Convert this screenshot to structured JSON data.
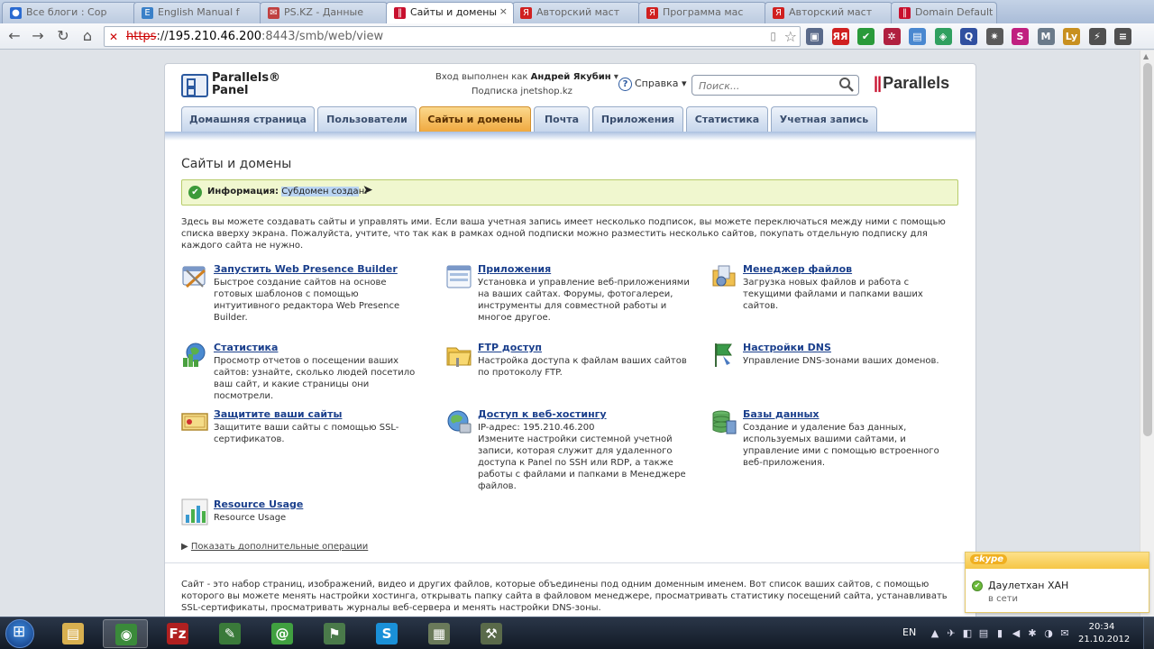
{
  "browser": {
    "tabs": [
      {
        "label": "Все блоги : Сор",
        "icon_color": "#2a6ad0",
        "glyph": "●"
      },
      {
        "label": "English Manual f",
        "icon_color": "#3a80c8",
        "glyph": "E"
      },
      {
        "label": "PS.KZ - Данные",
        "icon_color": "#c04040",
        "glyph": "✉"
      },
      {
        "label": "Сайты и домены",
        "icon_color": "#c8102e",
        "glyph": "‖"
      },
      {
        "label": "Авторский маст",
        "icon_color": "#d02020",
        "glyph": "Я"
      },
      {
        "label": "Программа мас",
        "icon_color": "#d02020",
        "glyph": "Я"
      },
      {
        "label": "Авторский маст",
        "icon_color": "#d02020",
        "glyph": "Я"
      },
      {
        "label": "Domain Default",
        "icon_color": "#c8102e",
        "glyph": "‖"
      }
    ],
    "tab_close_glyph": "×",
    "url_scheme": "https",
    "url_rest": "://",
    "url_host": "195.210.46.200",
    "url_path": ":8443/smb/web/view",
    "nav_back": "←",
    "nav_forward": "→",
    "nav_reload": "↻",
    "nav_home": "⌂",
    "security_glyph": "✕",
    "star_glyph": "☆",
    "extensions": [
      {
        "name": "ext-photo-icon",
        "color": "#5a6a8a",
        "glyph": "▣"
      },
      {
        "name": "ext-yandex-icon",
        "color": "#d02020",
        "glyph": "ЯЯ"
      },
      {
        "name": "ext-check-icon",
        "color": "#2a9a3a",
        "glyph": "✔"
      },
      {
        "name": "ext-puzzle-icon",
        "color": "#b02040",
        "glyph": "✲"
      },
      {
        "name": "ext-doc-icon",
        "color": "#4a88d0",
        "glyph": "▤"
      },
      {
        "name": "ext-color-icon",
        "color": "#30a060",
        "glyph": "◈"
      },
      {
        "name": "ext-translate-icon",
        "color": "#3050a0",
        "glyph": "Q"
      },
      {
        "name": "ext-gear-icon",
        "color": "#5a5a5a",
        "glyph": "✷"
      },
      {
        "name": "ext-s-icon",
        "color": "#c02080",
        "glyph": "S"
      },
      {
        "name": "ext-mail-icon",
        "color": "#6a7a8a",
        "glyph": "M"
      },
      {
        "name": "ext-ly-icon",
        "color": "#c89020",
        "glyph": "Ly"
      },
      {
        "name": "ext-bolt-icon",
        "color": "#505050",
        "glyph": "⚡"
      },
      {
        "name": "ext-menu-icon",
        "color": "#505050",
        "glyph": "≡"
      }
    ]
  },
  "header": {
    "logo_line1": "Parallels®",
    "logo_line2": "Panel",
    "login_prefix": "Вход выполнен как",
    "login_user": "Андрей Якубин",
    "login_caret": "▾",
    "subscription": "Подписка jnetshop.kz",
    "help_label": "Справка",
    "help_glyph": "?",
    "help_caret": "▾",
    "search_placeholder": "Поиск...",
    "brand": "Parallels",
    "brand_bars": "||"
  },
  "nav": {
    "tabs": [
      {
        "label": "Домашняя страница"
      },
      {
        "label": "Пользователи"
      },
      {
        "label": "Сайты и домены"
      },
      {
        "label": "Почта"
      },
      {
        "label": "Приложения"
      },
      {
        "label": "Статистика"
      },
      {
        "label": "Учетная запись"
      }
    ],
    "active_index": 2
  },
  "main": {
    "title": "Сайты и домены",
    "info_label": "Информация:",
    "info_selected": "Субдомен созда",
    "info_rest": "н.",
    "info_glyph": "✔",
    "intro": "Здесь вы можете создавать сайты и управлять ими. Если ваша учетная запись имеет несколько подписок, вы можете переключаться между ними с помощью списка вверху экрана. Пожалуйста, учтите, что так как в рамках одной подписки можно разместить несколько сайтов, покупать отдельную подписку для каждого сайта не нужно.",
    "features": [
      {
        "title": "Запустить Web Presence Builder",
        "desc": "Быстрое создание сайтов на основе готовых шаблонов с помощью интуитивного редактора Web Presence Builder."
      },
      {
        "title": "Приложения",
        "desc": "Установка и управление веб-приложениями на ваших сайтах. Форумы, фотогалереи, инструменты для совместной работы и многое другое."
      },
      {
        "title": "Менеджер файлов",
        "desc": "Загрузка новых файлов и работа с текущими файлами и папками ваших сайтов."
      },
      {
        "title": "Статистика",
        "desc": "Просмотр отчетов о посещении ваших сайтов: узнайте, сколько людей посетило ваш сайт, и какие страницы они посмотрели."
      },
      {
        "title": "FTP доступ",
        "desc": "Настройка доступа к файлам ваших сайтов по протоколу FTP."
      },
      {
        "title": "Настройки DNS",
        "desc": "Управление DNS-зонами ваших доменов."
      },
      {
        "title": "Защитите ваши сайты",
        "desc": "Защитите ваши сайты с помощью SSL-сертификатов."
      },
      {
        "title": "Доступ к веб-хостингу",
        "desc": "IP-адрес: 195.210.46.200\nИзмените настройки системной учетной записи, которая служит для удаленного доступа к Panel по SSH или RDP, а также работы с файлами и папками в Менеджере файлов."
      },
      {
        "title": "Базы данных",
        "desc": "Создание и удаление баз данных, используемых вашими сайтами, и управление ими с помощью встроенного веб-приложения."
      },
      {
        "title": "Resource Usage",
        "desc": "Resource Usage"
      }
    ],
    "more_arrow": "▶",
    "more_label": "Показать дополнительные операции",
    "bottom_text": "Сайт - это набор страниц, изображений, видео и других файлов, которые объединены под одним доменным именем. Вот список ваших сайтов, с помощью которого вы можете менять настройки хостинга, открывать папку сайта в файловом менеджере, просматривать статистику посещений сайта, устанавливать SSL-сертификаты, просматривать журналы веб-сервера и менять настройки DNS-зоны."
  },
  "skype": {
    "logo": "skype",
    "contact": "Даулетхан ХАН",
    "status": "в сети"
  },
  "taskbar": {
    "apps": [
      {
        "name": "explorer-icon",
        "color": "#d8b050",
        "glyph": "▤"
      },
      {
        "name": "chrome-icon",
        "color": "#3a8a3a",
        "glyph": "◉"
      },
      {
        "name": "filezilla-icon",
        "color": "#b02020",
        "glyph": "Fz"
      },
      {
        "name": "notepad-icon",
        "color": "#3a7a3a",
        "glyph": "✎"
      },
      {
        "name": "mail-agent-icon",
        "color": "#40a040",
        "glyph": "@"
      },
      {
        "name": "network-icon",
        "color": "#4a7a4a",
        "glyph": "⚑"
      },
      {
        "name": "skype-icon",
        "color": "#1a90d8",
        "glyph": "S"
      },
      {
        "name": "archive-icon",
        "color": "#6a7a5a",
        "glyph": "▦"
      },
      {
        "name": "tool-icon",
        "color": "#5a6a4a",
        "glyph": "⚒"
      }
    ],
    "active_index": 1,
    "lang": "EN",
    "tray_icons": [
      "▲",
      "✈",
      "◧",
      "▤",
      "▮",
      "◀",
      "✱",
      "◑",
      "✉"
    ],
    "time": "20:34",
    "date": "21.10.2012"
  }
}
